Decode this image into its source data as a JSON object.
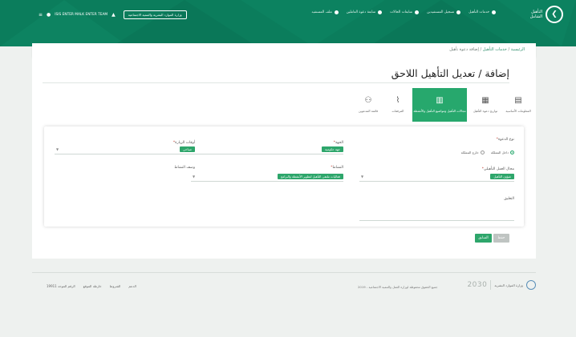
{
  "header": {
    "logo_text": "التأهيل الشامل",
    "nav": [
      {
        "label": "خدمات التأهيل"
      },
      {
        "label": "تسجيل المستفيدين"
      },
      {
        "label": "متابعات الحالات"
      },
      {
        "label": "متابعة دعوة العاملين"
      },
      {
        "label": "ملف المستفيد"
      }
    ],
    "user_name": "ISIS ENTER MALK ENTER TEAM",
    "switch_button": "وزارة الموارد البشرية والتنمية الاجتماعية"
  },
  "breadcrumb": {
    "home": "الرئيسية",
    "sep": "/",
    "parent": "خدمات التأهيل",
    "current": "إضافة دعوة تأهيل"
  },
  "page": {
    "title": "إضافة / تعديل التأهيل اللاحق"
  },
  "steps": [
    {
      "label": "المعلومات الأساسية",
      "icon": "doc-icon"
    },
    {
      "label": "تواريخ دعوة التأهيل",
      "icon": "calendar-icon"
    },
    {
      "label": "مجالات التأهيل ومواضيع التأهيل والأنشطة",
      "icon": "grid-icon"
    },
    {
      "label": "المرفقات",
      "icon": "paperclip-icon"
    },
    {
      "label": "قائمة المدعوين",
      "icon": "people-icon"
    }
  ],
  "form": {
    "call_type_label": "نوع الدعوة",
    "radio_internal": "داخل المملكة",
    "radio_external": "خارج المملكة",
    "destination_label": "الجهة",
    "destination_tag": "جهة حكومية",
    "time_label": "أوقات الزيارة",
    "time_tag": "صباحي",
    "work_field_label": "مجال العمل التأهيلي",
    "work_field_tag": "شؤون التأهيل",
    "activity_label": "النشاط",
    "activity_tag": "فعاليات ملتقى التأهيل لتطوير الأنشطة والبرامج",
    "activity_desc_label": "وصف النشاط",
    "notes_label": "التعليق"
  },
  "actions": {
    "save": "حفظ",
    "back": "السابق"
  },
  "footer": {
    "vision": "2030",
    "ministry": "وزارة الموارد البشرية",
    "copyright": "2019 - جميع الحقوق محفوظة لوزارة العمل والتنمية الاجتماعية",
    "links": [
      "الدعم",
      "الشروط",
      "خارطة الموقع"
    ],
    "contact": "الرقم الموحد 19911"
  }
}
